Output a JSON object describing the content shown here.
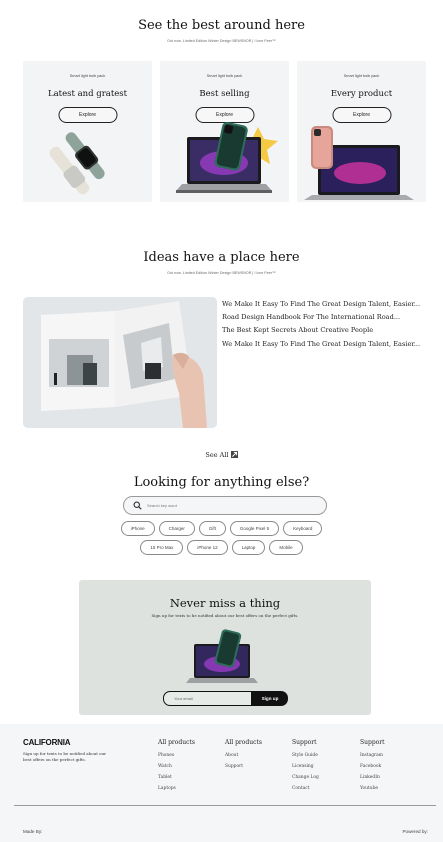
{
  "hero": {
    "title": "See the best around here",
    "subtitle": "Out now. Limited Edition Winter Design BEWSNOR | I love Peer™"
  },
  "products": [
    {
      "kicker": "Smart light bulb pack",
      "heading": "Latest and gratest",
      "button": "Explore"
    },
    {
      "kicker": "Smart light bulb pack",
      "heading": "Best selling",
      "button": "Explore"
    },
    {
      "kicker": "Smart light bulb pack",
      "heading": "Every product",
      "button": "Explore"
    }
  ],
  "ideas": {
    "title": "Ideas have a place here",
    "subtitle": "Out now. Limited Edition Winter Design BEWSNOR | I love Peer™",
    "articles": [
      "We Make It Easy To Find The Great Design Talent, Easier...",
      "Road Design Handbook For The International Road...",
      "The Best Kept Secrets About Creative People",
      "We Make It Easy To Find The Great Design Talent, Easier..."
    ],
    "see_all": "See All",
    "arrow_icon": "arrow-up-right-icon"
  },
  "search": {
    "title": "Looking for anything else?",
    "placeholder": "Search key word",
    "chips_row1": [
      "iPhone",
      "Charger",
      "Gift",
      "Google Pixel 5",
      "Keyboard"
    ],
    "chips_row2": [
      "15 Pro Max",
      "iPhone 12",
      "Laptop",
      "Mobile"
    ]
  },
  "newsletter": {
    "title": "Never miss a thing",
    "subtitle": "Sign up for texts to be notified about our best offers on the perfect gifts.",
    "email_placeholder": "Your email",
    "button": "Sign up"
  },
  "footer": {
    "brand": "CALIFORNIA",
    "tagline": "Sign up for texts to be notified about our best offers on the perfect gifts.",
    "columns": [
      {
        "heading": "All products",
        "items": [
          "Phones",
          "Watch",
          "Tablet",
          "Laptops"
        ]
      },
      {
        "heading": "All products",
        "items": [
          "About",
          "Support"
        ]
      },
      {
        "heading": "Support",
        "items": [
          "Style Guide",
          "Licensing",
          "Change Log",
          "Contact"
        ]
      },
      {
        "heading": "Support",
        "items": [
          "Instagram",
          "Facebook",
          "LinkedIn",
          "Youtube"
        ]
      }
    ],
    "made_by": "Made By:",
    "powered_by": "Powered by:"
  },
  "colors": {
    "card_bg": "#f3f4f6",
    "newsletter_bg": "#dde2df",
    "footer_bg": "#f5f6f8",
    "ink": "#111111"
  }
}
